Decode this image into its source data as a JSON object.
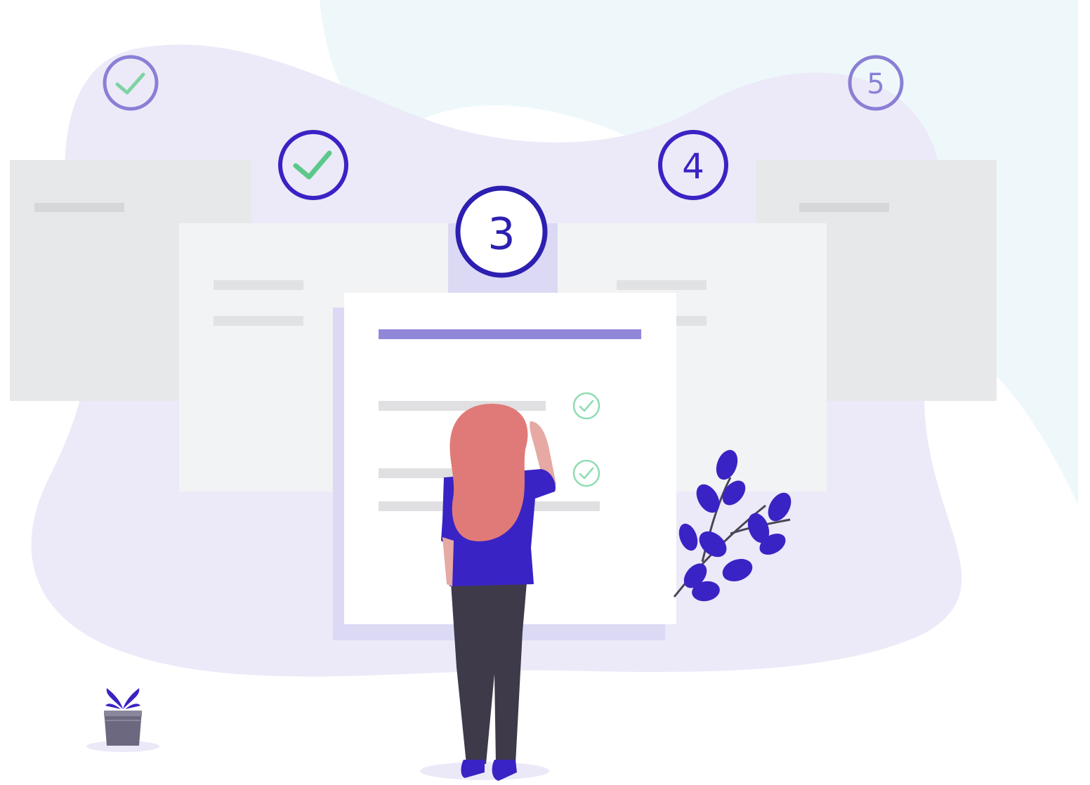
{
  "illustration": {
    "steps": [
      {
        "id": 1,
        "state": "completed",
        "label": "",
        "icon": "check-icon"
      },
      {
        "id": 2,
        "state": "completed",
        "label": "",
        "icon": "check-icon"
      },
      {
        "id": 3,
        "state": "current",
        "label": "3"
      },
      {
        "id": 4,
        "state": "upcoming",
        "label": "4"
      },
      {
        "id": 5,
        "state": "upcoming",
        "label": "5"
      }
    ],
    "form_checks": [
      {
        "state": "checked",
        "icon": "check-circle-icon"
      },
      {
        "state": "checked",
        "icon": "check-circle-icon"
      }
    ],
    "colors": {
      "accent": "#3a23c4",
      "accent_light": "#8a7fd6",
      "check_green": "#5ac98a",
      "blob_lavender": "#ebe9f8",
      "blob_mint": "#eef8fa",
      "card_light": "#f2f3f4",
      "card_mid": "#e7e8ea",
      "placeholder_line": "#e0e0e2",
      "form_header_bar": "#9187d9",
      "hair": "#e07a78",
      "shirt": "#3a23c4",
      "pants": "#3e3a4a"
    },
    "decor": [
      "plant-icon",
      "potted-plant-icon",
      "person-figure"
    ]
  }
}
